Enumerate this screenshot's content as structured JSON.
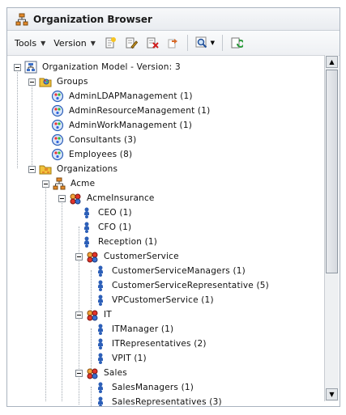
{
  "window": {
    "title": "Organization Browser"
  },
  "toolbar": {
    "tools_label": "Tools",
    "version_label": "Version",
    "icons": [
      "new-icon",
      "edit-icon",
      "delete-icon",
      "move-icon",
      "search-icon",
      "refresh-icon"
    ]
  },
  "tree": {
    "model": "Organization Model - Version: 3",
    "groups_label": "Groups",
    "groups": [
      "AdminLDAPManagement  (1)",
      "AdminResourceManagement  (1)",
      "AdminWorkManagement  (1)",
      "Consultants  (3)",
      "Employees  (8)"
    ],
    "organizations_label": "Organizations",
    "acme": "Acme",
    "acme_insurance": "AcmeInsurance",
    "top_positions": [
      "CEO  (1)",
      "CFO  (1)",
      "Reception  (1)"
    ],
    "customer_service": "CustomerService",
    "cs_positions": [
      "CustomerServiceManagers  (1)",
      "CustomerServiceRepresentative  (5)",
      "VPCustomerService  (1)"
    ],
    "it": "IT",
    "it_positions": [
      "ITManager  (1)",
      "ITRepresentatives  (2)",
      "VPIT  (1)"
    ],
    "sales": "Sales",
    "sales_positions": [
      "SalesManagers  (1)",
      "SalesRepresentatives  (3)"
    ]
  },
  "colors": {
    "accent": "#2c5fb8",
    "folder": "#f0c23b"
  }
}
